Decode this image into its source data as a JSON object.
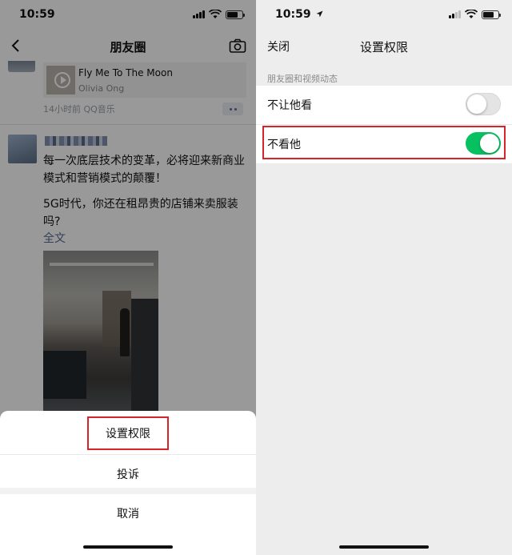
{
  "left_screen": {
    "status_time": "10:59",
    "nav": {
      "title": "朋友圈"
    },
    "music_post": {
      "song_title": "Fly Me To The Moon",
      "artist": "Olivia Ong",
      "time_source": "14小时前  QQ音乐"
    },
    "post": {
      "text_line1": "每一次底层技术的变革，必将迎来新商业模式和营销模式的颠覆！",
      "text_line2": "5G时代，你还在租昂贵的店铺来卖服装吗?",
      "full_text_link": "全文"
    },
    "action_sheet": {
      "items": [
        "设置权限",
        "投诉"
      ],
      "cancel": "取消"
    }
  },
  "right_screen": {
    "status_time": "10:59",
    "nav": {
      "close": "关闭",
      "title": "设置权限"
    },
    "section_label": "朋友圈和视频动态",
    "settings": [
      {
        "label": "不让他看",
        "enabled": false
      },
      {
        "label": "不看他",
        "enabled": true
      }
    ]
  },
  "colors": {
    "highlight_border": "#d8232a",
    "toggle_on": "#07c160",
    "link": "#576b95"
  },
  "icons": [
    "back-icon",
    "camera-icon",
    "play-icon",
    "more-icon",
    "signal-icon",
    "wifi-icon",
    "battery-icon",
    "location-arrow-icon"
  ]
}
